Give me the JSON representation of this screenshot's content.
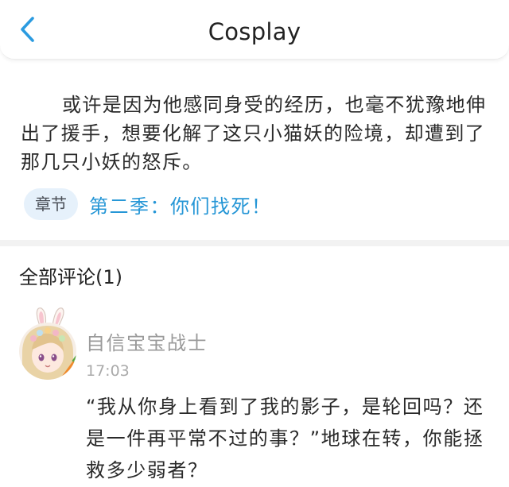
{
  "header": {
    "title": "Cosplay",
    "back_icon": "chevron-left-icon",
    "accent": "#2b9be0"
  },
  "article": {
    "text": "或许是因为他感同身受的经历，也毫不犹豫地伸出了援手，想要化解了这只小猫妖的险境，却遭到了那几只小妖的怒斥。"
  },
  "chapter": {
    "tag_label": "章节",
    "title": "第二季：你们找死！",
    "link_color": "#2596d6"
  },
  "comments": {
    "heading": "全部评论(1)",
    "items": [
      {
        "avatar": "avatar-icon",
        "username": "自信宝宝战士",
        "time": "17:03",
        "text": "“我从你身上看到了我的影子，是轮回吗？还是一件再平常不过的事？”地球在转，你能拯救多少弱者？"
      }
    ]
  }
}
